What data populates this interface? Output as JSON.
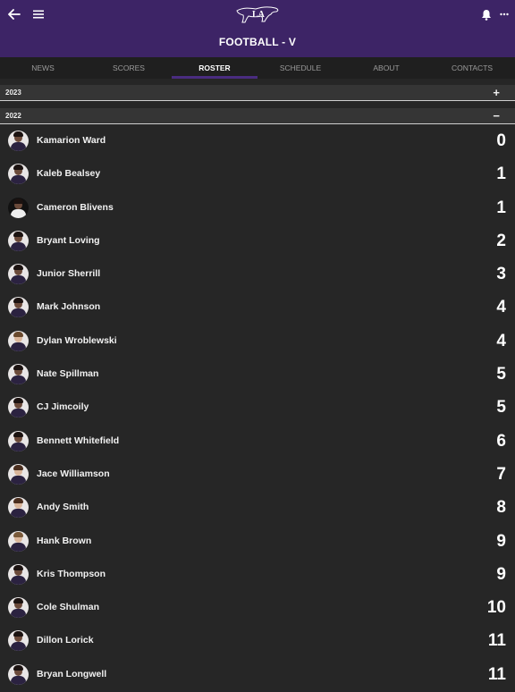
{
  "header": {
    "title": "FOOTBALL - V",
    "back_icon": "back-arrow-icon",
    "menu_icon": "hamburger-menu-icon",
    "bell_icon": "bell-icon",
    "more_icon": "more-dots-icon",
    "logo": "LA"
  },
  "tabs": [
    {
      "label": "NEWS",
      "active": false
    },
    {
      "label": "SCORES",
      "active": false
    },
    {
      "label": "ROSTER",
      "active": true
    },
    {
      "label": "SCHEDULE",
      "active": false
    },
    {
      "label": "ABOUT",
      "active": false
    },
    {
      "label": "CONTACTS",
      "active": false
    }
  ],
  "sections": [
    {
      "year": "2023",
      "toggle": "+"
    },
    {
      "year": "2022",
      "toggle": "−"
    }
  ],
  "players": [
    {
      "name": "Kamarion Ward",
      "number": "0"
    },
    {
      "name": "Kaleb Bealsey",
      "number": "1"
    },
    {
      "name": "Cameron Blivens",
      "number": "1"
    },
    {
      "name": "Bryant Loving",
      "number": "2"
    },
    {
      "name": "Junior Sherrill",
      "number": "3"
    },
    {
      "name": "Mark Johnson",
      "number": "4"
    },
    {
      "name": "Dylan Wroblewski",
      "number": "4"
    },
    {
      "name": "Nate Spillman",
      "number": "5"
    },
    {
      "name": "CJ Jimcoily",
      "number": "5"
    },
    {
      "name": "Bennett Whitefield",
      "number": "6"
    },
    {
      "name": "Jace Williamson",
      "number": "7"
    },
    {
      "name": "Andy Smith",
      "number": "8"
    },
    {
      "name": "Hank Brown",
      "number": "9"
    },
    {
      "name": "Kris Thompson",
      "number": "9"
    },
    {
      "name": "Cole Shulman",
      "number": "10"
    },
    {
      "name": "Dillon Lorick",
      "number": "11"
    },
    {
      "name": "Bryan Longwell",
      "number": "11"
    }
  ],
  "colors": {
    "header_bg": "#3d2466",
    "tab_bar_bg": "#1f1f1f",
    "tab_indicator": "#4a2c80",
    "list_bg": "#262626"
  }
}
